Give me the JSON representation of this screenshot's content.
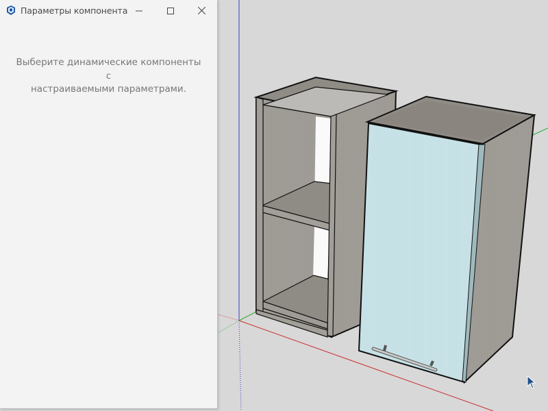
{
  "dialog": {
    "title": "Параметры компонента",
    "message_line1": "Выберите динамические компоненты с",
    "message_line2": "настраиваемыми параметрами.",
    "app_icon": "sketchup-logo-icon",
    "controls": [
      "minimize-icon",
      "maximize-icon",
      "close-icon"
    ]
  },
  "viewport": {
    "background": "#d8d8d8",
    "axis_colors": {
      "x": "#cc2b2b",
      "y": "#2fa83a",
      "z": "#3340c8"
    },
    "models": [
      "open-shelf-cabinet",
      "wall-cabinet-with-door"
    ],
    "door_color": "#c7e3e8",
    "body_color": "#8e8a84"
  }
}
